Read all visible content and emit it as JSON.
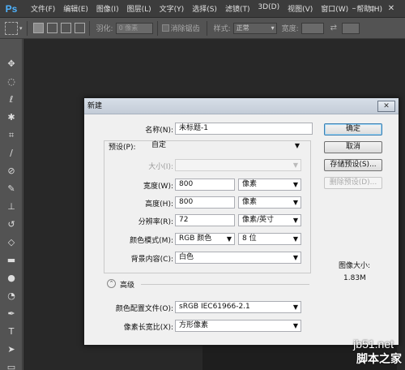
{
  "app": {
    "logo": "Ps"
  },
  "menu": [
    "文件(F)",
    "编辑(E)",
    "图像(I)",
    "图层(L)",
    "文字(Y)",
    "选择(S)",
    "滤镜(T)",
    "3D(D)",
    "视图(V)",
    "窗口(W)",
    "帮助(H)"
  ],
  "options": {
    "feather_label": "羽化:",
    "feather_value": "0 像素",
    "antialias_label": "消除锯齿",
    "style_label": "样式:",
    "style_value": "正常",
    "width_label": "宽度:"
  },
  "dialog": {
    "title": "新建",
    "name_label": "名称(N):",
    "name_value": "未标题-1",
    "preset_label": "预设(P):",
    "preset_value": "自定",
    "size_label": "大小(I):",
    "width_label": "宽度(W):",
    "width_value": "800",
    "width_unit": "像素",
    "height_label": "高度(H):",
    "height_value": "800",
    "height_unit": "像素",
    "resolution_label": "分辨率(R):",
    "resolution_value": "72",
    "resolution_unit": "像素/英寸",
    "color_mode_label": "颜色模式(M):",
    "color_mode_value": "RGB 颜色",
    "bit_depth_value": "8 位",
    "background_label": "背景内容(C):",
    "background_value": "白色",
    "advanced_label": "高级",
    "profile_label": "颜色配置文件(O):",
    "profile_value": "sRGB IEC61966-2.1",
    "pixel_aspect_label": "像素长宽比(X):",
    "pixel_aspect_value": "方形像素",
    "buttons": {
      "ok": "确定",
      "cancel": "取消",
      "save_preset": "存储预设(S)...",
      "delete_preset": "删除预设(D)..."
    },
    "image_size_label": "图像大小:",
    "image_size_value": "1.83M"
  },
  "watermark": {
    "url": "jb51.net",
    "name": "脚本之家"
  }
}
